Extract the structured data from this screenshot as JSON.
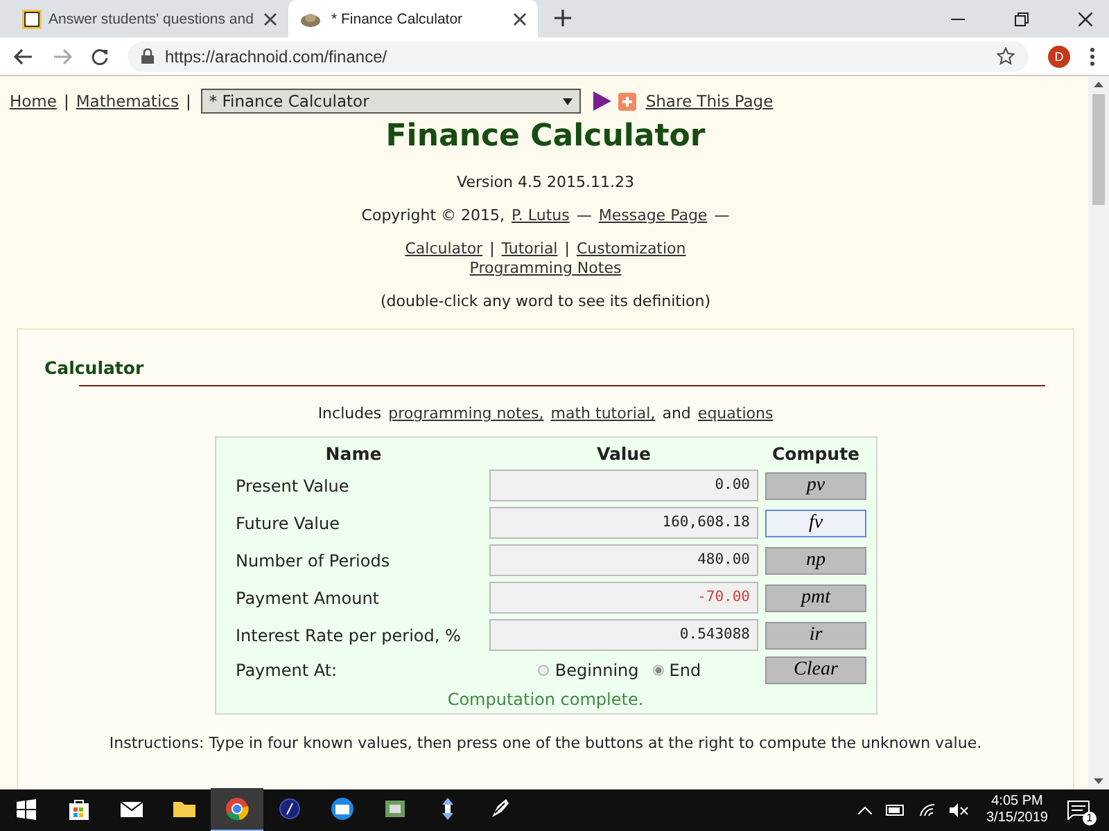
{
  "browser": {
    "tabs": [
      {
        "title": "Answer students' questions and",
        "selected": false
      },
      {
        "title": "* Finance Calculator",
        "selected": true
      }
    ],
    "url": "https://arachnoid.com/finance/",
    "profile_initial": "D"
  },
  "page": {
    "nav": [
      {
        "kind": "link",
        "text": "Home"
      },
      {
        "kind": "text",
        "text": "|"
      },
      {
        "kind": "link",
        "text": "Mathematics"
      },
      {
        "kind": "text",
        "text": "|"
      }
    ],
    "page_select": "* Finance Calculator",
    "share_label": "Share This Page",
    "title": "Finance Calculator",
    "version": "Version 4.5 2015.11.23",
    "copyright": [
      {
        "kind": "text",
        "text": "Copyright © 2015,"
      },
      {
        "kind": "link",
        "text": "P. Lutus"
      },
      {
        "kind": "text",
        "text": "—"
      },
      {
        "kind": "link",
        "text": "Message Page"
      },
      {
        "kind": "text",
        "text": "—"
      }
    ],
    "links": [
      {
        "kind": "link",
        "text": "Calculator"
      },
      {
        "kind": "text",
        "text": "|"
      },
      {
        "kind": "link",
        "text": "Tutorial"
      },
      {
        "kind": "text",
        "text": "|"
      },
      {
        "kind": "link",
        "text": "Customization"
      }
    ],
    "links_2": [
      {
        "kind": "link",
        "text": "Programming Notes"
      }
    ],
    "hint": "(double-click any word to see its definition)",
    "section_title": "Calculator",
    "includes": [
      {
        "kind": "text",
        "text": "Includes"
      },
      {
        "kind": "link",
        "text": "programming notes,"
      },
      {
        "kind": "link",
        "text": "math tutorial,"
      },
      {
        "kind": "text",
        "text": "and"
      },
      {
        "kind": "link",
        "text": "equations"
      }
    ],
    "calculator": {
      "columns": [
        "Name",
        "Value",
        "Compute"
      ],
      "rows": [
        {
          "name": "Present Value",
          "value": "0.00",
          "negative": false,
          "button": "pv",
          "focused": false
        },
        {
          "name": "Future Value",
          "value": "160,608.18",
          "negative": false,
          "button": "fv",
          "focused": true
        },
        {
          "name": "Number of Periods",
          "value": "480.00",
          "negative": false,
          "button": "np",
          "focused": false
        },
        {
          "name": "Payment Amount",
          "value": "-70.00",
          "negative": true,
          "button": "pmt",
          "focused": false
        },
        {
          "name": "Interest Rate per period, %",
          "value": "0.543088",
          "negative": false,
          "button": "ir",
          "focused": false
        }
      ],
      "payment_at": {
        "label": "Payment At:",
        "options": [
          {
            "label": "Beginning",
            "selected": false
          },
          {
            "label": "End",
            "selected": true
          }
        ]
      },
      "clear_button": "Clear",
      "status": "Computation complete."
    },
    "instructions": "Instructions: Type in four known values, then press one of the buttons at the right to compute the unknown value."
  },
  "taskbar": {
    "time": "4:05 PM",
    "date": "3/15/2019",
    "notification_count": "1"
  }
}
